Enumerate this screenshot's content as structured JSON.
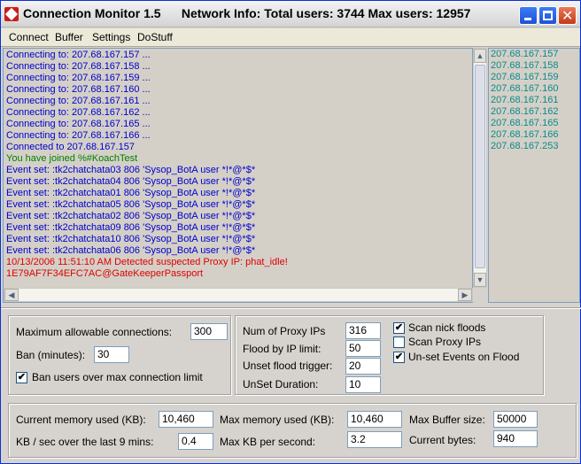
{
  "window": {
    "title": "Connection Monitor 1.5      Network Info: Total users: 3744 Max users: 12957",
    "controls": {
      "minimize": "minimize-icon",
      "maximize": "maximize-icon",
      "close": "close-icon"
    }
  },
  "menu": [
    "Connect",
    "Buffer",
    "Settings",
    "DoStuff"
  ],
  "log": {
    "colors": {
      "connect": "#0000cc",
      "joined": "#008000",
      "event": "#0000cc",
      "alert": "#e00000"
    },
    "lines": [
      {
        "text": "Connecting to: 207.68.167.157 ...",
        "kind": "connect"
      },
      {
        "text": "Connecting to: 207.68.167.158 ...",
        "kind": "connect"
      },
      {
        "text": "Connecting to: 207.68.167.159 ...",
        "kind": "connect"
      },
      {
        "text": "Connecting to: 207.68.167.160 ...",
        "kind": "connect"
      },
      {
        "text": "Connecting to: 207.68.167.161 ...",
        "kind": "connect"
      },
      {
        "text": "Connecting to: 207.68.167.162 ...",
        "kind": "connect"
      },
      {
        "text": "Connecting to: 207.68.167.165 ...",
        "kind": "connect"
      },
      {
        "text": "Connecting to: 207.68.167.166 ...",
        "kind": "connect"
      },
      {
        "text": "Connected to 207.68.167.157",
        "kind": "connect"
      },
      {
        "text": "You have joined %#KoachTest",
        "kind": "joined"
      },
      {
        "text": "Event set: :tk2chatchata03 806 'Sysop_BotA user *!*@*$*",
        "kind": "event"
      },
      {
        "text": "Event set: :tk2chatchata04 806 'Sysop_BotA user *!*@*$*",
        "kind": "event"
      },
      {
        "text": "Event set: :tk2chatchata01 806 'Sysop_BotA user *!*@*$*",
        "kind": "event"
      },
      {
        "text": "Event set: :tk2chatchata05 806 'Sysop_BotA user *!*@*$*",
        "kind": "event"
      },
      {
        "text": "Event set: :tk2chatchata02 806 'Sysop_BotA user *!*@*$*",
        "kind": "event"
      },
      {
        "text": "Event set: :tk2chatchata09 806 'Sysop_BotA user *!*@*$*",
        "kind": "event"
      },
      {
        "text": "Event set: :tk2chatchata10 806 'Sysop_BotA user *!*@*$*",
        "kind": "event"
      },
      {
        "text": "Event set: :tk2chatchata06 806 'Sysop_BotA user *!*@*$*",
        "kind": "event"
      },
      {
        "text": "10/13/2006 11:51:10 AM Detected suspected Proxy IP:            phat_idle!",
        "kind": "alert"
      },
      {
        "text": "1E79AF7F34EFC7AC@GateKeeperPassport",
        "kind": "alert"
      }
    ]
  },
  "servers": [
    "207.68.167.157",
    "207.68.167.158",
    "207.68.167.159",
    "207.68.167.160",
    "207.68.167.161",
    "207.68.167.162",
    "207.68.167.165",
    "207.68.167.166",
    "207.68.167.253"
  ],
  "limits": {
    "max_conn_label": "Maximum allowable connections:",
    "max_conn_value": "300",
    "ban_label": "Ban (minutes):",
    "ban_value": "30",
    "ban_over_label": "Ban users over max connection limit",
    "ban_over_checked": true
  },
  "flood": {
    "proxy_label": "Num of Proxy IPs",
    "proxy_value": "316",
    "floodip_label": "Flood by IP limit:",
    "floodip_value": "50",
    "unset_trigger_label": "Unset flood trigger:",
    "unset_trigger_value": "20",
    "unset_duration_label": "UnSet Duration:",
    "unset_duration_value": "10",
    "scan_nick_label": "Scan nick floods",
    "scan_nick_checked": true,
    "scan_proxy_label": "Scan Proxy IPs",
    "scan_proxy_checked": false,
    "unset_events_label": "Un-set Events on Flood",
    "unset_events_checked": true
  },
  "stats": {
    "cur_mem_label": "Current memory used (KB):",
    "cur_mem_value": "10,460",
    "max_mem_label": "Max memory used (KB):",
    "max_mem_value": "10,460",
    "max_buf_label": "Max Buffer size:",
    "max_buf_value": "50000",
    "kbsec_label": "KB / sec over the last  9 mins:",
    "kbsec_value": "0.4",
    "max_kb_label": "Max KB per second:",
    "max_kb_value": "3.2",
    "cur_bytes_label": "Current bytes:",
    "cur_bytes_value": "940"
  }
}
